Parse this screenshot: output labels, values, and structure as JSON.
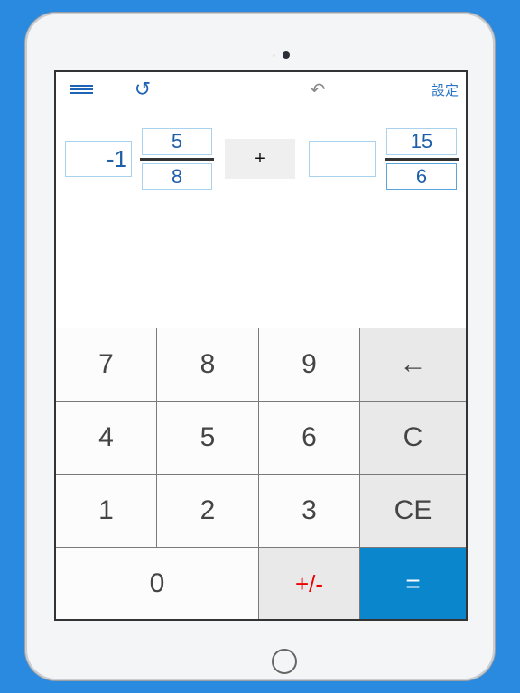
{
  "toolbar": {
    "menu_icon": "menu-icon",
    "refresh_icon": "↺",
    "undo_icon": "↶",
    "settings_label": "設定"
  },
  "expression": {
    "left": {
      "whole": "-1",
      "numerator": "5",
      "denominator": "8"
    },
    "operator": "+",
    "right": {
      "whole": "",
      "numerator": "15",
      "denominator": "6"
    }
  },
  "keypad": {
    "keys": [
      "7",
      "8",
      "9",
      "←",
      "4",
      "5",
      "6",
      "C",
      "1",
      "2",
      "3",
      "CE",
      "0",
      "+/-",
      "="
    ]
  },
  "colors": {
    "background": "#2a8ae0",
    "accent": "#0a86cc",
    "value_text": "#1d5fa8",
    "sign_key": "#e00000"
  }
}
